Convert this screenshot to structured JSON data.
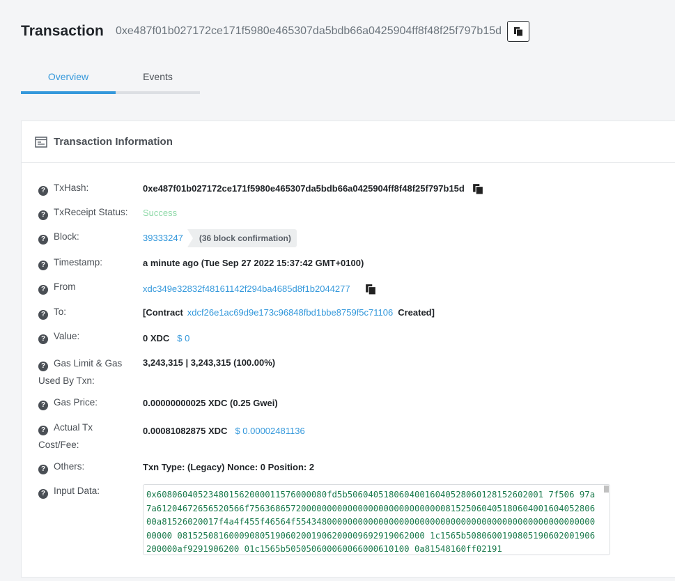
{
  "header": {
    "title": "Transaction",
    "hash": "0xe487f01b027172ce171f5980e465307da5bdb66a0425904ff8f48f25f797b15d"
  },
  "tabs": [
    {
      "label": "Overview",
      "active": true
    },
    {
      "label": "Events",
      "active": false
    }
  ],
  "card": {
    "title": "Transaction Information",
    "rows": {
      "txhash": {
        "label": "TxHash:",
        "value": "0xe487f01b027172ce171f5980e465307da5bdb66a0425904ff8f48f25f797b15d"
      },
      "status": {
        "label": "TxReceipt Status:",
        "value": "Success"
      },
      "block": {
        "label": "Block:",
        "value": "39333247",
        "confirmation": "(36 block confirmation)"
      },
      "timestamp": {
        "label": "Timestamp:",
        "value": "a minute ago (Tue Sep 27 2022 15:37:42 GMT+0100)"
      },
      "from": {
        "label": "From",
        "value": "xdc349e32832f48161142f294ba4685d8f1b2044277"
      },
      "to": {
        "label": "To:",
        "prefix": "[Contract",
        "address": "xdcf26e1ac69d9e173c96848fbd1bbe8759f5c71106",
        "suffix": "Created]"
      },
      "value": {
        "label": "Value:",
        "amount": "0 XDC",
        "usd": "$ 0"
      },
      "gas": {
        "label_line1": "Gas Limit & Gas",
        "label_line2": "Used By Txn:",
        "value": "3,243,315 | 3,243,315 (100.00%)"
      },
      "gas_price": {
        "label": "Gas Price:",
        "value": "0.00000000025 XDC (0.25 Gwei)"
      },
      "fee": {
        "label_line1": "Actual Tx",
        "label_line2": "Cost/Fee:",
        "amount": "0.00081082875 XDC",
        "usd": "$ 0.00002481136"
      },
      "others": {
        "label": "Others:",
        "value": "Txn Type: (Legacy) Nonce: 0 Position: 2"
      },
      "input": {
        "label": "Input Data:",
        "value": "0x608060405234801562000011576000080fd5b50604051806040016040528060128152602001 7f506 97a7a61204672656520566f7563686572000000000000000000000000000081525060405180604001604052806 00a81526020017f4a4f455f46564f554348000000000000000000000000000000000000000000000000000000000 081525081600090805190602001906200009692919062000 1c1565b5080600190805190602001906200000af9291906200 01c1565b505050600060066000610100 0a81548160ff02191"
      }
    }
  },
  "colors": {
    "accent": "#3498db",
    "success": "#8fd9a8",
    "input_text": "#1a7a4c"
  }
}
